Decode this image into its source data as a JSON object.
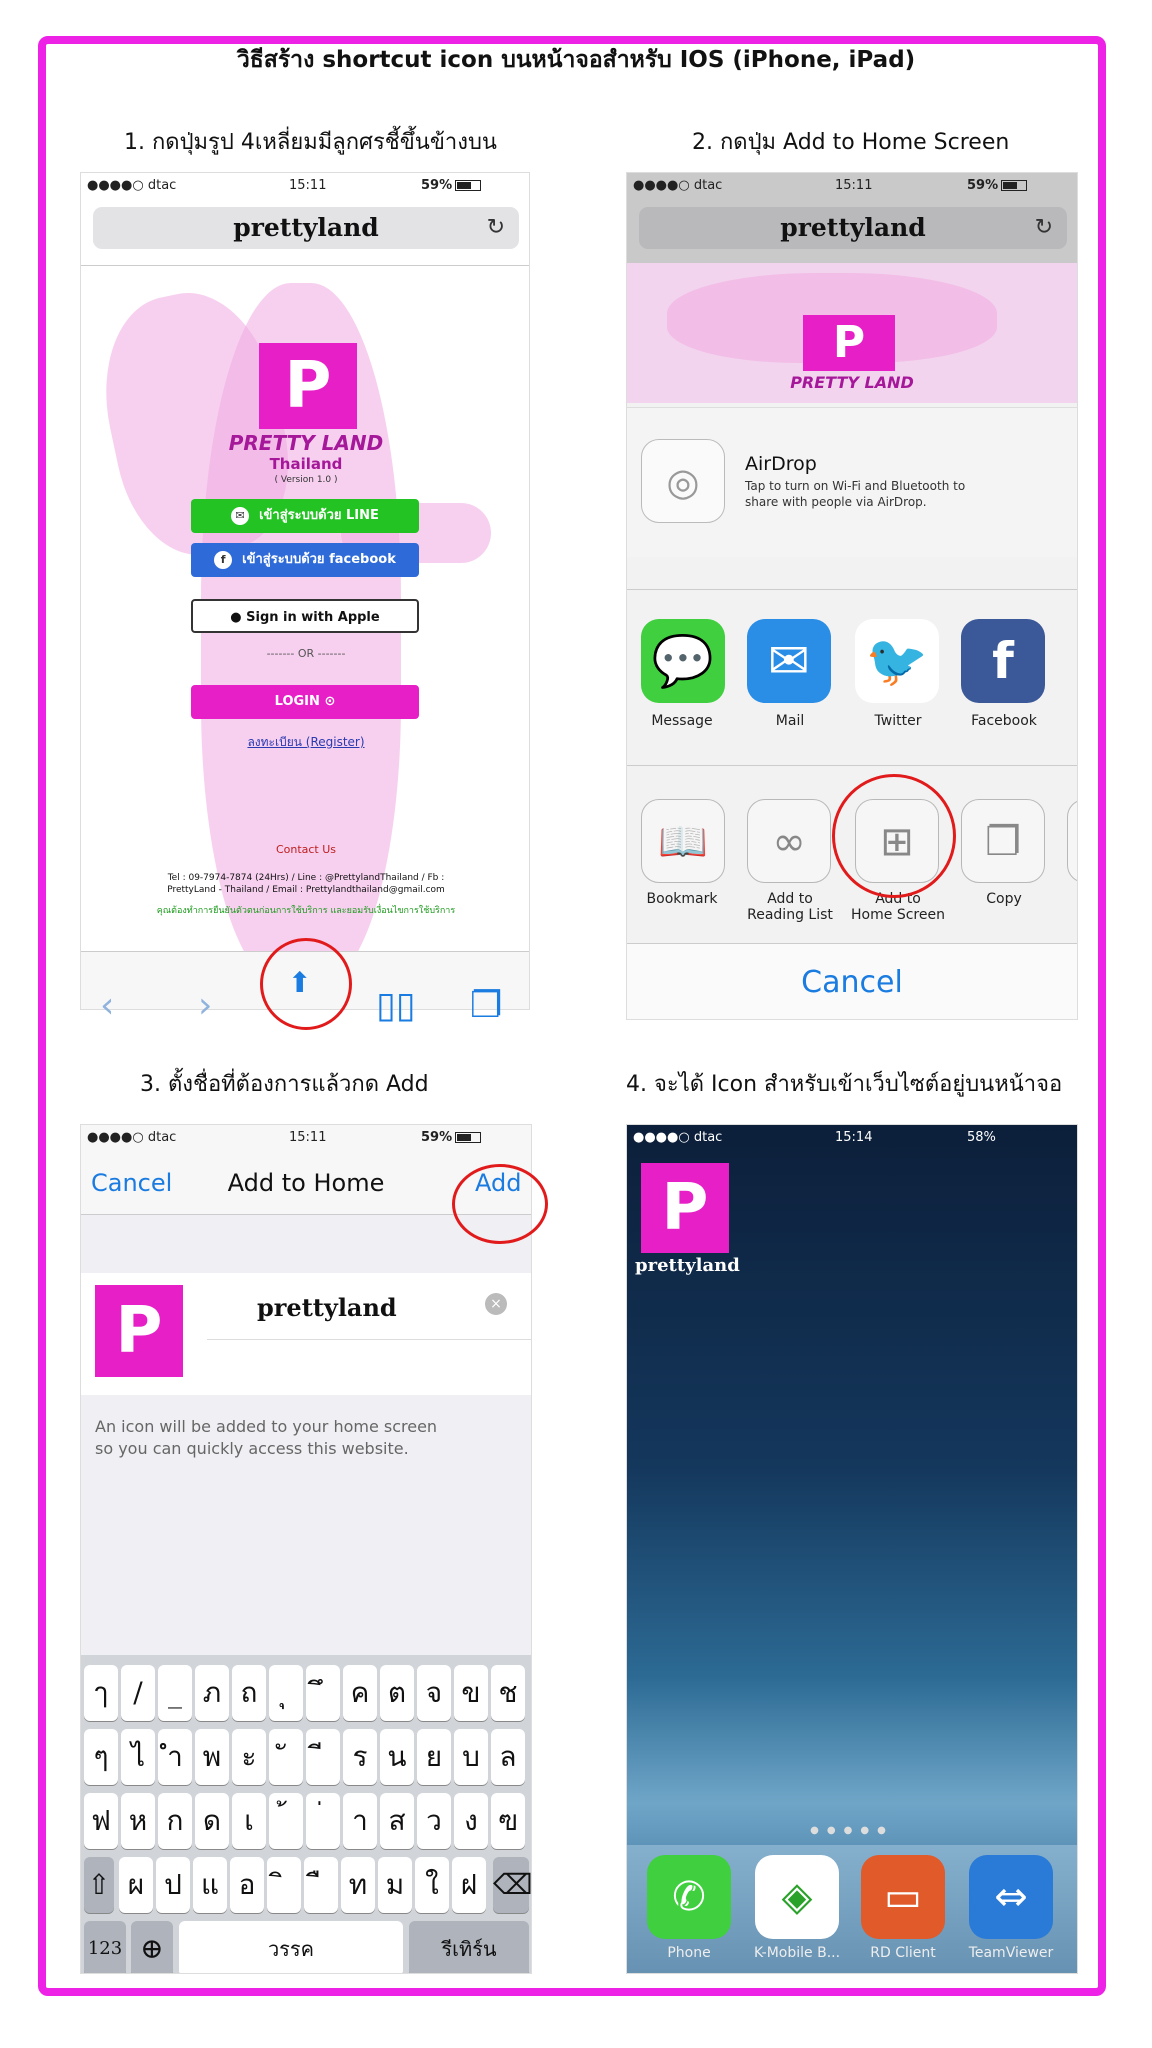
{
  "title": "วิธีสร้าง shortcut icon บนหน้าจอสำหรับ IOS (iPhone, iPad)",
  "steps": [
    "1. กดปุ่มรูป 4เหลี่ยมมีลูกศรชี้ขึ้นข้างบน",
    "2. กดปุ่ม Add to Home Screen",
    "3. ตั้งชื่อที่ต้องการแล้วกด Add",
    "4. จะได้ Icon สำหรับเข้าเว็บไซต์อยู่บนหน้าจอ"
  ],
  "status": {
    "carrier": "●●●●○ dtac",
    "time1": "15:11",
    "time4": "15:14",
    "battery": "59%",
    "battery4": "58%"
  },
  "url": "prettyland",
  "reload_icon": "↻",
  "login": {
    "logo_letter": "P",
    "brand": "PRETTY LAND",
    "brand_sub": "Thailand",
    "version": "( Version 1.0 )",
    "line_btn": "เข้าสู่ระบบด้วย LINE",
    "fb_btn": "เข้าสู่ระบบด้วย facebook",
    "apple_btn": "Sign in with Apple",
    "or": "------- OR -------",
    "login_btn": "LOGIN",
    "register": "ลงทะเบียน (Register)",
    "contact": "Contact Us",
    "footer1": "Tel : 09-7974-7874 (24Hrs) / Line : @PrettylandThailand / Fb :",
    "footer2": "PrettyLand - Thailand / Email : Prettylandthailand@gmail.com",
    "footer3": "คุณต้องทำการยืนยันตัวตนก่อนการใช้บริการ และยอมรับเงื่อนไขการใช้บริการ"
  },
  "share": {
    "airdrop_title": "AirDrop",
    "airdrop_desc1": "Tap to turn on Wi-Fi and Bluetooth to",
    "airdrop_desc2": "share with people via AirDrop.",
    "apps": [
      "Message",
      "Mail",
      "Twitter",
      "Facebook"
    ],
    "actions": [
      "Bookmark",
      "Add to\nReading List",
      "Add to\nHome Screen",
      "Copy"
    ],
    "cancel": "Cancel"
  },
  "addhome": {
    "cancel": "Cancel",
    "title": "Add to Home",
    "add": "Add",
    "name": "prettyland",
    "hint1": "An icon will be added to your home screen",
    "hint2": "so you can quickly access this website.",
    "row1": [
      "ๅ",
      "/",
      "_",
      "ภ",
      "ถ",
      "ุ",
      "ึ",
      "ค",
      "ต",
      "จ",
      "ข",
      "ช"
    ],
    "row2": [
      "ๆ",
      "ไ",
      "ำ",
      "พ",
      "ะ",
      "ั",
      "ี",
      "ร",
      "น",
      "ย",
      "บ",
      "ล"
    ],
    "row3": [
      "ฟ",
      "ห",
      "ก",
      "ด",
      "เ",
      "้",
      "่",
      "า",
      "ส",
      "ว",
      "ง",
      "ฃ"
    ],
    "row4": [
      "ผ",
      "ป",
      "แ",
      "อ",
      "ิ",
      "ื",
      "ท",
      "ม",
      "ใ",
      "ฝ"
    ],
    "k123": "123",
    "space": "วรรค",
    "return": "รีเทิร์น"
  },
  "home": {
    "icon_label": "prettyland",
    "dock": [
      "Phone",
      "K-Mobile B...",
      "RD Client",
      "TeamViewer"
    ]
  },
  "colors": {
    "frame": "#ee22e6",
    "brand": "#e620c6",
    "line": "#22c322",
    "facebook": "#2f6bd8",
    "ios_blue": "#1a7be0",
    "circle": "#e11b1b"
  }
}
